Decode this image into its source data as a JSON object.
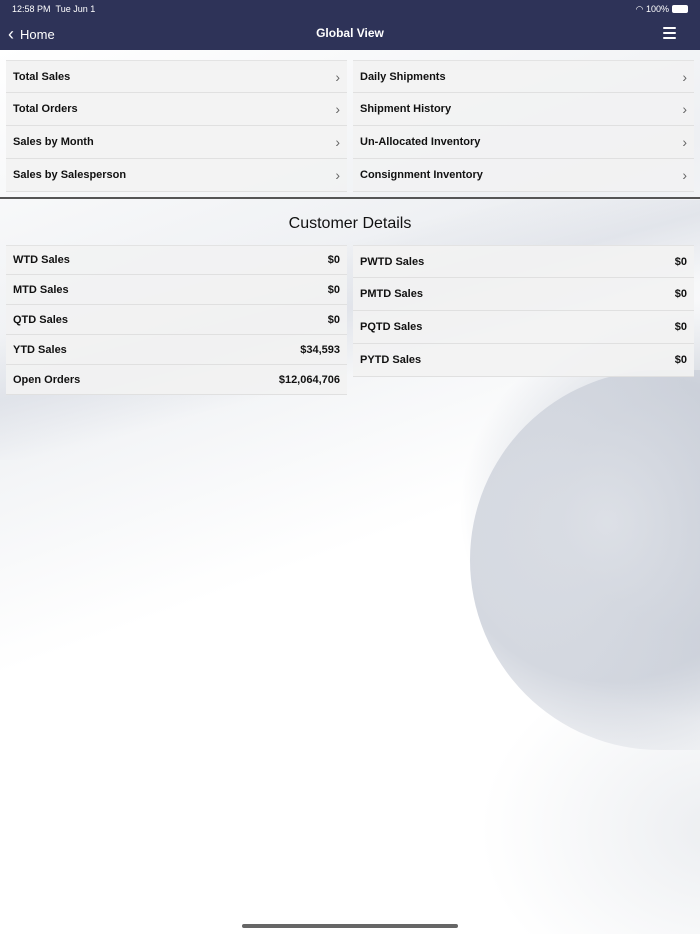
{
  "status": {
    "time": "12:58 PM",
    "date": "Tue Jun 1",
    "battery": "100%"
  },
  "nav": {
    "back": "Home",
    "title": "Global View"
  },
  "menu_left": [
    "Total Sales",
    "Total Orders",
    "Sales by Month",
    "Sales by Salesperson"
  ],
  "menu_right": [
    "Daily Shipments",
    "Shipment History",
    "Un-Allocated Inventory",
    "Consignment Inventory"
  ],
  "section_title": "Customer Details",
  "details_left": [
    {
      "label": "WTD Sales",
      "value": "$0"
    },
    {
      "label": "MTD Sales",
      "value": "$0"
    },
    {
      "label": "QTD Sales",
      "value": "$0"
    },
    {
      "label": "YTD Sales",
      "value": "$34,593"
    },
    {
      "label": "Open Orders",
      "value": "$12,064,706"
    }
  ],
  "details_right": [
    {
      "label": "PWTD Sales",
      "value": "$0"
    },
    {
      "label": "PMTD Sales",
      "value": "$0"
    },
    {
      "label": "PQTD Sales",
      "value": "$0"
    },
    {
      "label": "PYTD Sales",
      "value": "$0"
    }
  ]
}
